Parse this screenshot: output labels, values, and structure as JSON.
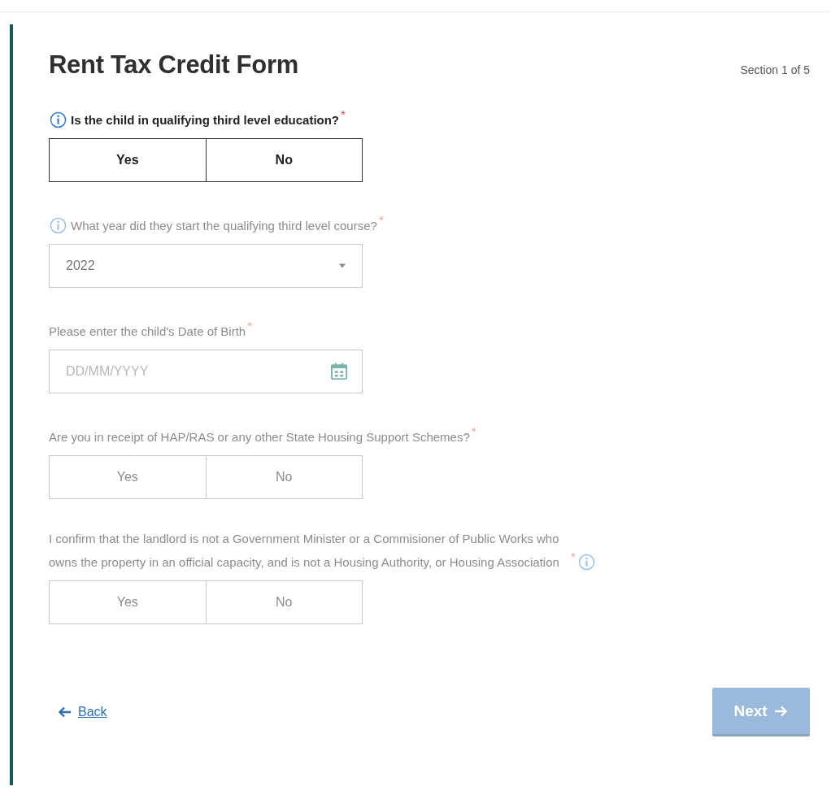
{
  "form": {
    "title": "Rent Tax Credit Form",
    "section": "Section 1 of 5",
    "questions": [
      {
        "kind": "toggle",
        "label": "Is the child in qualifying third level education?",
        "required_mark": "*",
        "info_before": true,
        "disabled": false,
        "options": [
          {
            "label": "Yes",
            "selected": false
          },
          {
            "label": "No",
            "selected": false
          }
        ]
      },
      {
        "kind": "select",
        "label": "What year did they start the qualifying third level course?",
        "required_mark": "*",
        "info_before": true,
        "disabled": true,
        "value": "2022"
      },
      {
        "kind": "date",
        "label": "Please enter the child's Date of Birth",
        "required_mark": "*",
        "disabled": true,
        "placeholder": "DD/MM/YYYY"
      },
      {
        "kind": "toggle",
        "label": "Are you in receipt of HAP/RAS or any other State Housing Support Schemes?",
        "required_mark": "*",
        "disabled": true,
        "options": [
          {
            "label": "Yes",
            "selected": false
          },
          {
            "label": "No",
            "selected": false
          }
        ]
      },
      {
        "kind": "toggle",
        "label": "I confirm that the landlord is not a Government Minister or a Commisioner of Public Works who owns the property in an official capacity, and is not a Housing Authority, or Housing Association",
        "required_mark": "*",
        "info_after": true,
        "disabled": true,
        "options": [
          {
            "label": "Yes",
            "selected": false
          },
          {
            "label": "No",
            "selected": false
          }
        ]
      }
    ],
    "back": {
      "label": "Back"
    },
    "next": {
      "label": "Next",
      "disabled": true
    }
  }
}
